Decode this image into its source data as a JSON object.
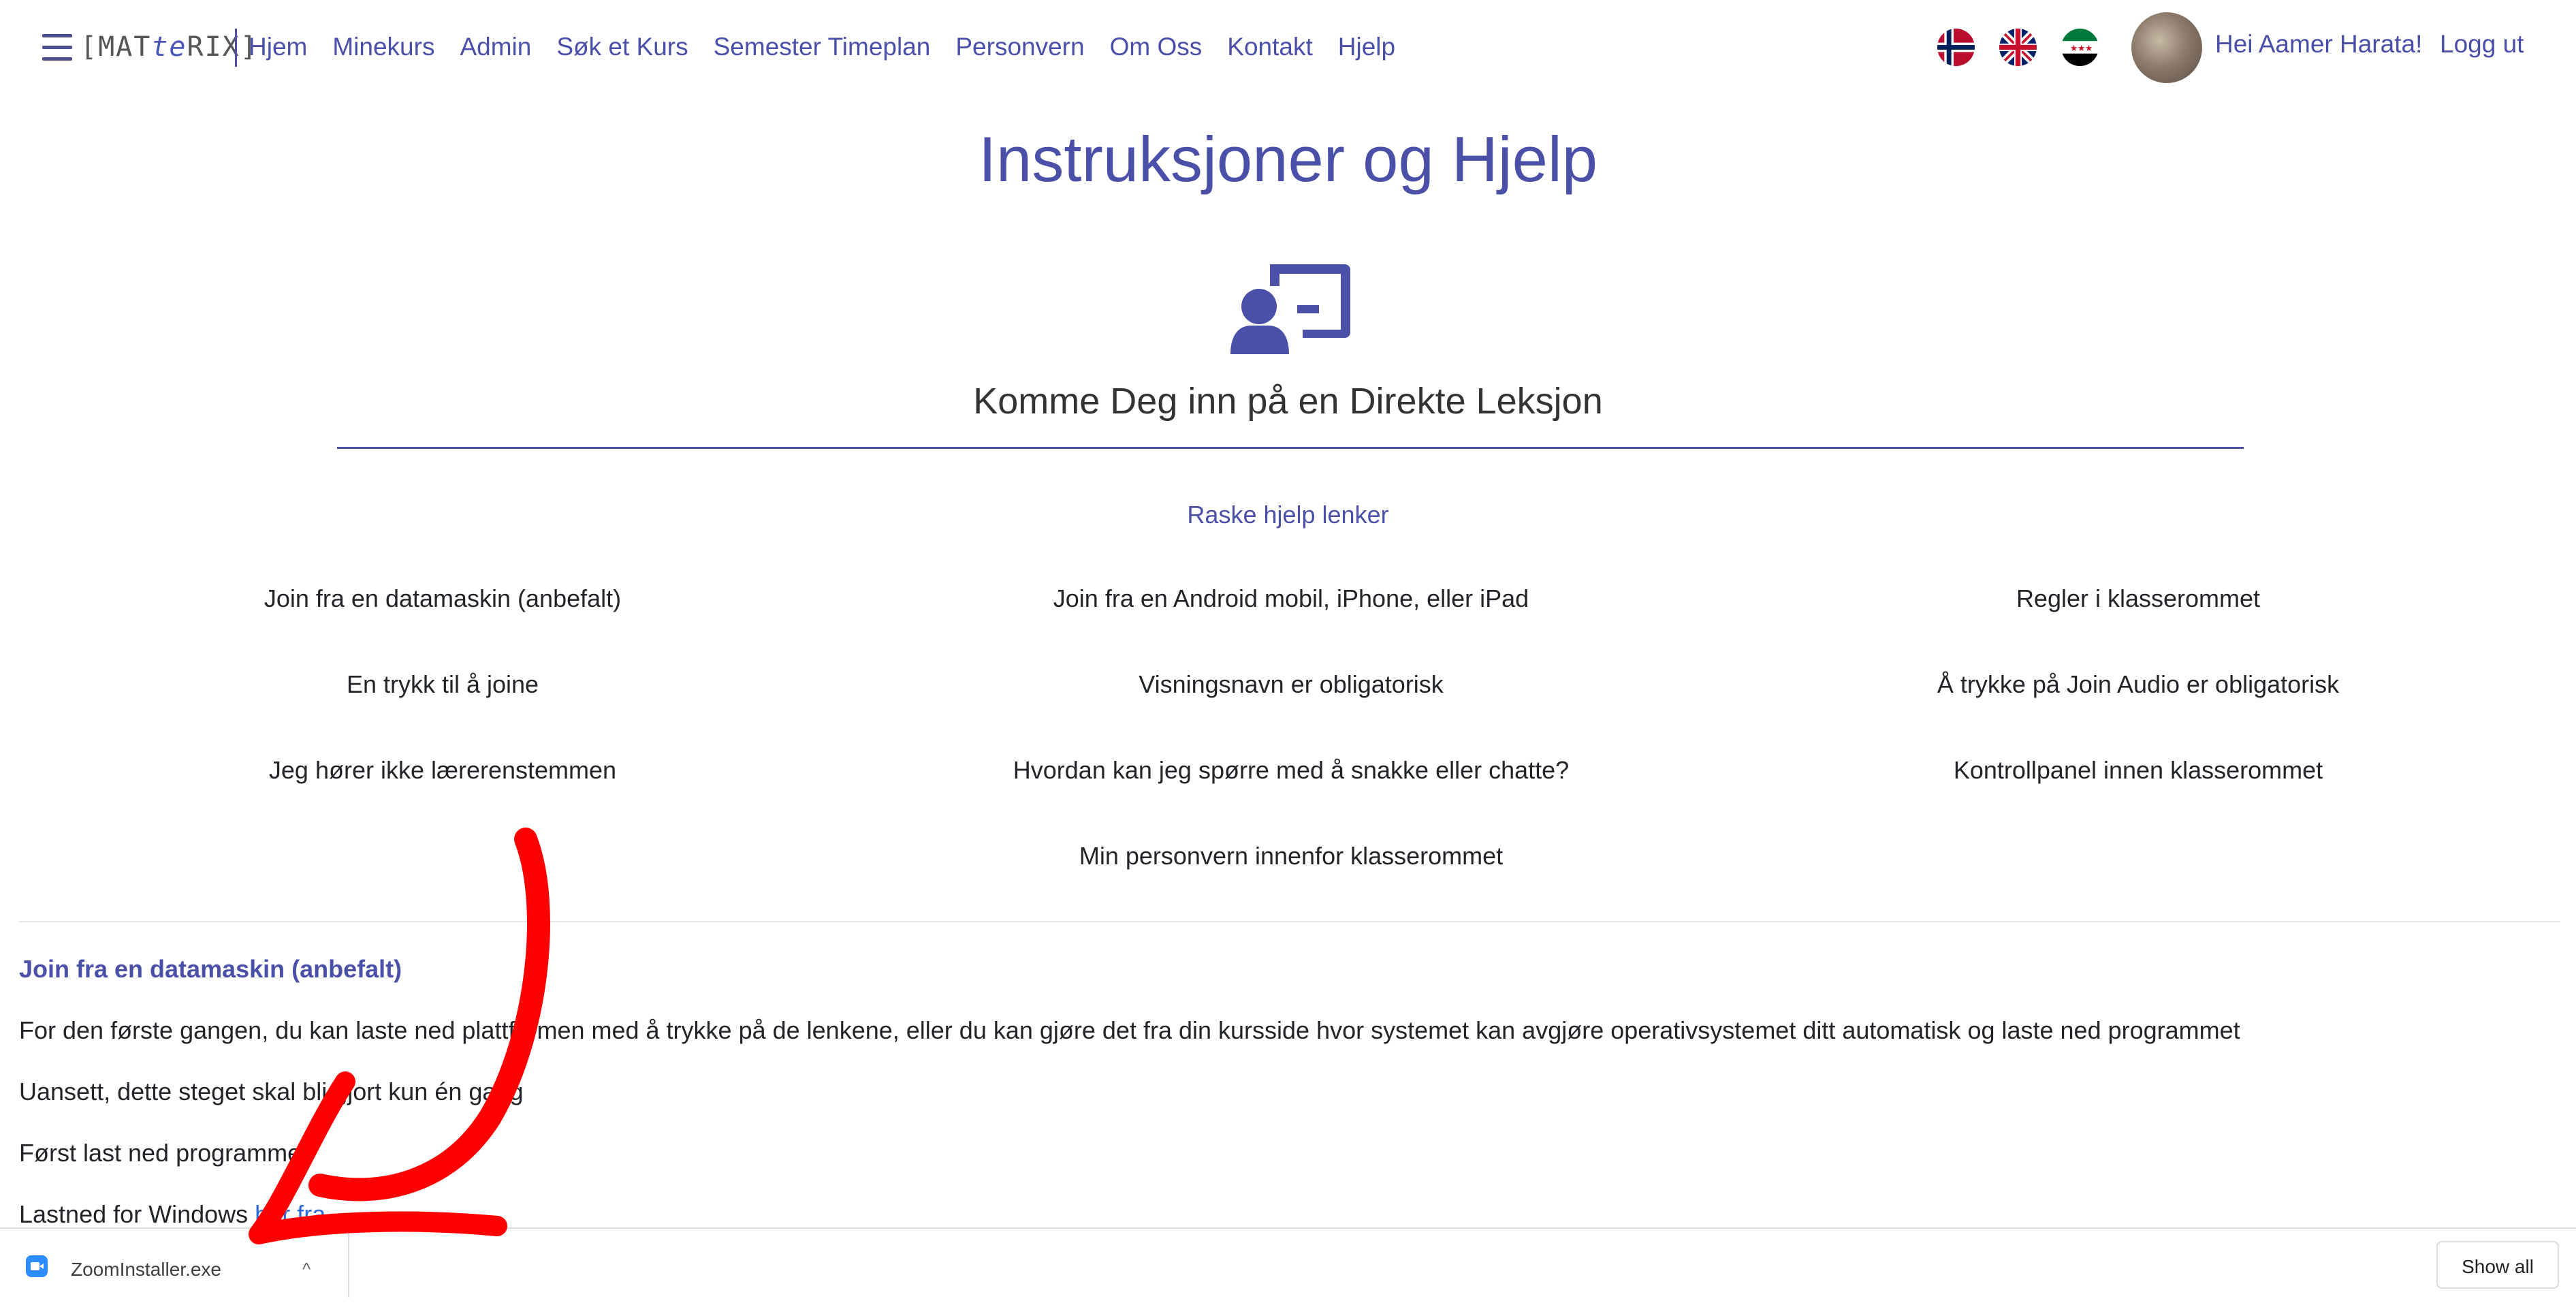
{
  "navbar": {
    "logo_left": "[MAT",
    "logo_mid": "te",
    "logo_right": "RIX]",
    "links": [
      "Hjem",
      "Minekurs",
      "Admin",
      "Søk et Kurs",
      "Semester Timeplan",
      "Personvern",
      "Om Oss",
      "Kontakt",
      "Hjelp"
    ],
    "greeting": "Hei Aamer Harata!",
    "logout": "Logg ut",
    "languages": [
      "norway-flag-icon",
      "uk-flag-icon",
      "syria-flag-icon"
    ]
  },
  "page": {
    "title": "Instruksjoner og Hjelp",
    "subtitle": "Komme Deg inn på en Direkte Leksjon",
    "quick_links_title": "Raske hjelp lenker",
    "quick_links": [
      "Join fra en datamaskin (anbefalt)",
      "Join fra en Android mobil, iPhone, eller iPad",
      "Regler i klasserommet",
      "En trykk til å joine",
      "Visningsnavn er obligatorisk",
      "Å trykke på Join Audio er obligatorisk",
      "Jeg hører ikke lærerenstemmen",
      "Hvordan kan jeg spørre med å snakke eller chatte?",
      "Kontrollpanel innen klasserommet",
      "Min personvern innenfor klasserommet"
    ]
  },
  "section": {
    "title": "Join fra en datamaskin (anbefalt)",
    "p1": "For den første gangen, du kan laste ned plattformen med å trykke på de lenkene, eller du kan gjøre det fra din kursside hvor systemet kan avgjøre operativsystemet ditt automatisk og laste ned programmet",
    "p2": "Uansett, dette steget skal bli gjort kun én gang",
    "p3": "Først last ned programmet",
    "p4_prefix": "Lastned for Windows ",
    "p4_link": "her fra"
  },
  "download_bar": {
    "file_name": "ZoomInstaller.exe",
    "chevron": "^",
    "show_all": "Show all"
  },
  "colors": {
    "brand": "#4a4fa8",
    "link": "#2a6ad8",
    "annotation": "#ff0000"
  }
}
